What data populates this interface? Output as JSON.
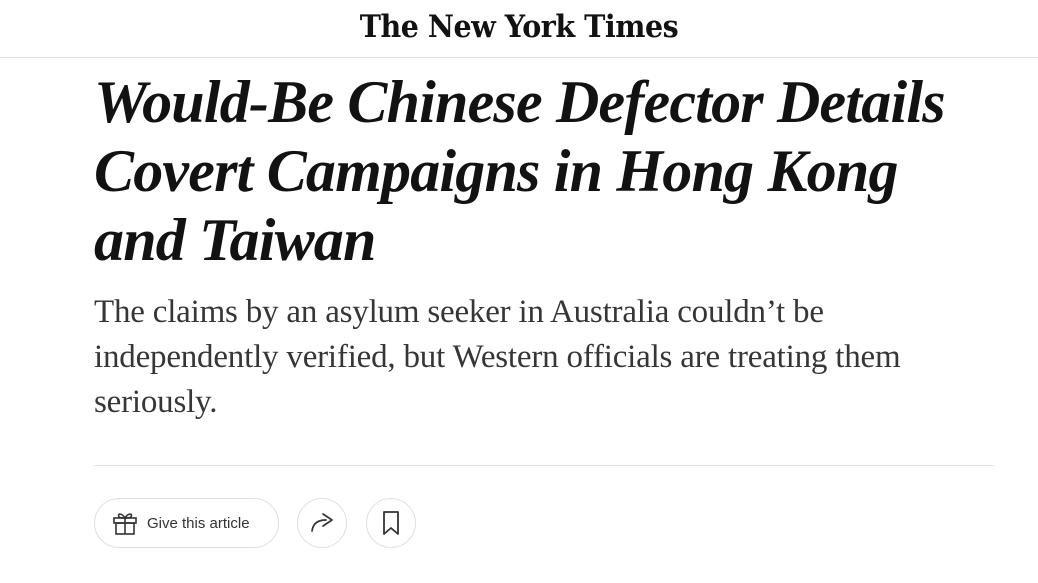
{
  "header": {
    "logo_text": "The New York Times"
  },
  "article": {
    "headline": "Would-Be Chinese Defector Details Covert Campaigns in Hong Kong and Taiwan",
    "summary": "The claims by an asylum seeker in Australia couldn’t be independently verified, but Western officials are treating them seriously."
  },
  "actions": {
    "gift_label": "Give this article",
    "icons": {
      "gift": "gift-icon",
      "share": "share-arrow-icon",
      "save": "bookmark-icon"
    }
  }
}
